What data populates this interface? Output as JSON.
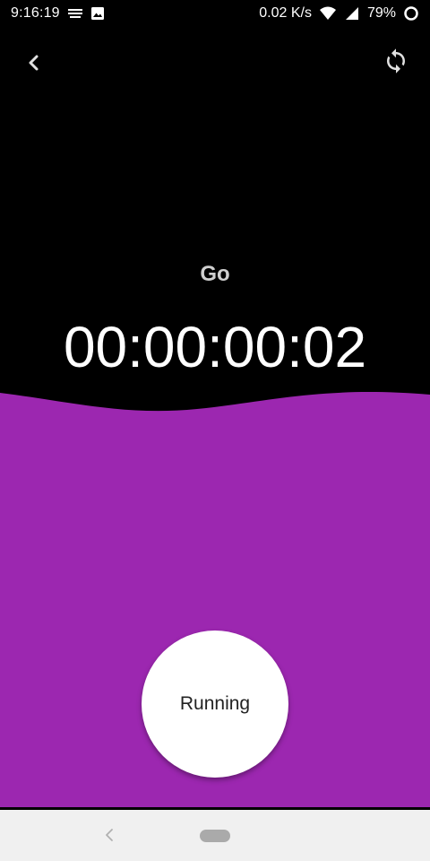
{
  "status_bar": {
    "time": "9:16:19",
    "net_speed": "0.02 K/s",
    "battery": "79%",
    "icons": [
      "sim-icon",
      "image-icon",
      "wifi-icon",
      "signal-icon",
      "battery-ring-icon"
    ]
  },
  "top_bar": {
    "back_icon": "chevron-left-icon",
    "refresh_icon": "refresh-icon"
  },
  "main": {
    "title": "Go",
    "timer": "00:00:00:02"
  },
  "run_button": {
    "label": "Running"
  },
  "colors": {
    "background": "#000000",
    "accent": "#9c27b0",
    "button": "#ffffff",
    "nav_bar": "#f0f0f0"
  }
}
